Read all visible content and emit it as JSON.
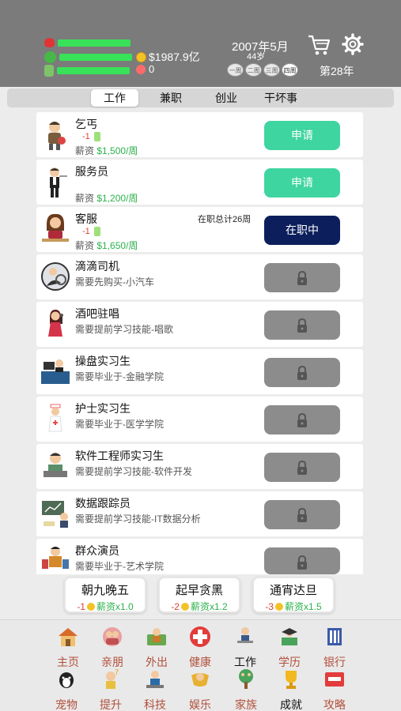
{
  "header": {
    "money": "$1987.9亿",
    "hearts": "0",
    "date": "2007年5月",
    "age": "44岁",
    "weeks": [
      "一周",
      "二周",
      "三周",
      "四周"
    ],
    "year": "第28年",
    "stats": [
      {
        "name": "health",
        "level": 1.0,
        "color": "#e03333"
      },
      {
        "name": "happiness",
        "level": 1.0,
        "color": "#47b847"
      },
      {
        "name": "energy",
        "level": 1.0,
        "color": "#7ec36a"
      }
    ]
  },
  "tabs": [
    "工作",
    "兼职",
    "创业",
    "干坏事"
  ],
  "jobs": [
    {
      "title": "乞丐",
      "cost": "-1",
      "salary_label": "薪资",
      "salary": "$1,500/周",
      "button": "申请",
      "state": "apply",
      "icon": "beggar-avatar"
    },
    {
      "title": "服务员",
      "salary_label": "薪资",
      "salary": "$1,200/周",
      "button": "申请",
      "state": "apply",
      "icon": "waiter-avatar"
    },
    {
      "title": "客服",
      "cost": "-1",
      "salary_label": "薪资",
      "salary": "$1,650/周",
      "tenure": "在职总计26周",
      "button": "在职中",
      "state": "working",
      "icon": "customer-service-avatar"
    },
    {
      "title": "滴滴司机",
      "requirement": "需要先购买-小汽车",
      "state": "locked",
      "icon": "driver-avatar"
    },
    {
      "title": "酒吧驻唱",
      "requirement": "需要提前学习技能-唱歌",
      "state": "locked",
      "icon": "singer-avatar"
    },
    {
      "title": "操盘实习生",
      "requirement": "需要毕业于-金融学院",
      "state": "locked",
      "icon": "trader-avatar"
    },
    {
      "title": "护士实习生",
      "requirement": "需要毕业于-医学学院",
      "state": "locked",
      "icon": "nurse-avatar"
    },
    {
      "title": "软件工程师实习生",
      "requirement": "需要提前学习技能-软件开发",
      "state": "locked",
      "icon": "engineer-avatar"
    },
    {
      "title": "数据跟踪员",
      "requirement": "需要提前学习技能-IT数据分析",
      "state": "locked",
      "icon": "analyst-avatar"
    },
    {
      "title": "群众演员",
      "requirement": "需要毕业于-艺术学院",
      "state": "locked",
      "icon": "actor-avatar"
    }
  ],
  "modes": [
    {
      "name": "朝九晚五",
      "cost": "-1",
      "pay": "薪资x1.0"
    },
    {
      "name": "起早贪黑",
      "cost": "-2",
      "pay": "薪资x1.2"
    },
    {
      "name": "通宵达旦",
      "cost": "-3",
      "pay": "薪资x1.5"
    }
  ],
  "nav": {
    "row1": [
      "主页",
      "亲朋",
      "外出",
      "健康",
      "工作",
      "学历",
      "银行"
    ],
    "row2": [
      "宠物",
      "提升",
      "科技",
      "娱乐",
      "家族",
      "成就",
      "攻略"
    ],
    "active": "工作"
  },
  "colors": {
    "header_bg": "#7b7b7b",
    "bar": "#38e258",
    "apply": "#3ed5a0",
    "working": "#0c1f5c",
    "locked": "#8c8c8c"
  }
}
